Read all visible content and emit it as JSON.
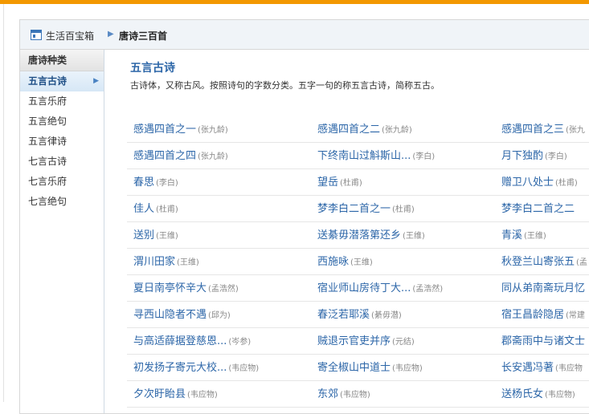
{
  "breadcrumb": {
    "home": "生活百宝箱",
    "current": "唐诗三百首"
  },
  "sidebar": {
    "heading": "唐诗种类",
    "items": [
      {
        "label": "五言古诗",
        "active": true
      },
      {
        "label": "五言乐府"
      },
      {
        "label": "五言绝句"
      },
      {
        "label": "五言律诗"
      },
      {
        "label": "七言古诗"
      },
      {
        "label": "七言乐府"
      },
      {
        "label": "七言绝句"
      }
    ]
  },
  "main": {
    "title": "五言古诗",
    "description": "古诗体，又称古风。按照诗句的字数分类。五字一句的称五言古诗，简称五古。"
  },
  "poems": [
    [
      {
        "title": "感遇四首之一",
        "author": "(张九龄)"
      },
      {
        "title": "感遇四首之二",
        "author": "(张九龄)"
      },
      {
        "title": "感遇四首之三",
        "author": "(张九"
      }
    ],
    [
      {
        "title": "感遇四首之四",
        "author": "(张九龄)"
      },
      {
        "title": "下终南山过斛斯山...",
        "author": "(李白)"
      },
      {
        "title": "月下独酌",
        "author": "(李白)"
      }
    ],
    [
      {
        "title": "春思",
        "author": "(李白)"
      },
      {
        "title": "望岳",
        "author": "(杜甫)"
      },
      {
        "title": "赠卫八处士",
        "author": "(杜甫)"
      }
    ],
    [
      {
        "title": "佳人",
        "author": "(杜甫)"
      },
      {
        "title": "梦李白二首之一",
        "author": "(杜甫)"
      },
      {
        "title": "梦李白二首之二",
        "author": ""
      }
    ],
    [
      {
        "title": "送别",
        "author": "(王维)"
      },
      {
        "title": "送綦毋潜落第还乡",
        "author": "(王维)"
      },
      {
        "title": "青溪",
        "author": "(王维)"
      }
    ],
    [
      {
        "title": "渭川田家",
        "author": "(王维)"
      },
      {
        "title": "西施咏",
        "author": "(王维)"
      },
      {
        "title": "秋登兰山寄张五",
        "author": "(孟"
      }
    ],
    [
      {
        "title": "夏日南亭怀辛大",
        "author": "(孟浩然)"
      },
      {
        "title": "宿业师山房待丁大...",
        "author": "(孟浩然)"
      },
      {
        "title": "同从弟南斋玩月忆",
        "author": ""
      }
    ],
    [
      {
        "title": "寻西山隐者不遇",
        "author": "(邱为)"
      },
      {
        "title": "春泛若耶溪",
        "author": "(綦毋潜)"
      },
      {
        "title": "宿王昌龄隐居",
        "author": "(常建"
      }
    ],
    [
      {
        "title": "与高适薛据登慈恩...",
        "author": "(岑参)"
      },
      {
        "title": "贼退示官吏并序",
        "author": "(元结)"
      },
      {
        "title": "郡斋雨中与诸文士",
        "author": ""
      }
    ],
    [
      {
        "title": "初发扬子寄元大校...",
        "author": "(韦应物)"
      },
      {
        "title": "寄全椒山中道士",
        "author": "(韦应物)"
      },
      {
        "title": "长安遇冯著",
        "author": "(韦应物"
      }
    ],
    [
      {
        "title": "夕次盱眙县",
        "author": "(韦应物)"
      },
      {
        "title": "东郊",
        "author": "(韦应物)"
      },
      {
        "title": "送杨氏女",
        "author": "(韦应物)"
      }
    ]
  ]
}
